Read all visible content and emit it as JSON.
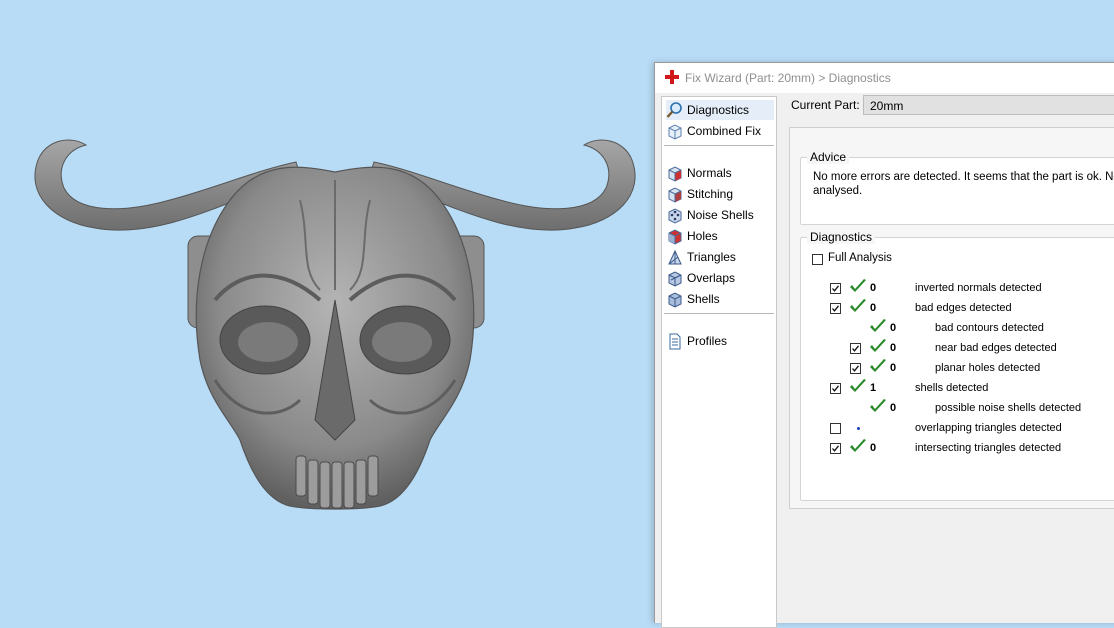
{
  "window": {
    "title": "Fix Wizard (Part: 20mm) > Diagnostics",
    "accent_color": "#d01818"
  },
  "nav": {
    "items": [
      {
        "label": "Diagnostics",
        "icon": "magnifier-icon",
        "selected": true
      },
      {
        "label": "Combined Fix",
        "icon": "cube-outline-icon"
      },
      {
        "label": "Normals",
        "icon": "cube-red-icon"
      },
      {
        "label": "Stitching",
        "icon": "cube-stitch-icon"
      },
      {
        "label": "Noise Shells",
        "icon": "cube-dots-icon"
      },
      {
        "label": "Holes",
        "icon": "cube-holes-icon"
      },
      {
        "label": "Triangles",
        "icon": "triangle-icon"
      },
      {
        "label": "Overlaps",
        "icon": "cube-overlap-icon"
      },
      {
        "label": "Shells",
        "icon": "cube-shells-icon"
      },
      {
        "label": "Profiles",
        "icon": "document-icon"
      }
    ]
  },
  "current_part": {
    "label": "Current Part:",
    "value": "20mm"
  },
  "advice": {
    "title": "Advice",
    "text": "No more errors are detected. It seems that the part is ok. No analysed."
  },
  "diagnostics": {
    "title": "Diagnostics",
    "full_analysis_label": "Full Analysis",
    "full_analysis_checked": false,
    "ok_color": "#2a8a2a",
    "rows": [
      {
        "checkbox": true,
        "checked": true,
        "status": "ok",
        "count": "0",
        "text": "inverted normals detected",
        "indent": 0
      },
      {
        "checkbox": true,
        "checked": true,
        "status": "ok",
        "count": "0",
        "text": "bad edges detected",
        "indent": 0
      },
      {
        "checkbox": false,
        "checked": false,
        "status": "ok",
        "count": "0",
        "text": "bad contours detected",
        "indent": 1
      },
      {
        "checkbox": true,
        "checked": true,
        "status": "ok",
        "count": "0",
        "text": "near bad edges detected",
        "indent": 1
      },
      {
        "checkbox": true,
        "checked": true,
        "status": "ok",
        "count": "0",
        "text": "planar holes detected",
        "indent": 1
      },
      {
        "checkbox": true,
        "checked": true,
        "status": "ok",
        "count": "1",
        "text": "shells detected",
        "indent": 0
      },
      {
        "checkbox": false,
        "checked": false,
        "status": "ok",
        "count": "0",
        "text": "possible noise shells detected",
        "indent": 1
      },
      {
        "checkbox": true,
        "checked": false,
        "status": "pending",
        "count": "",
        "text": "overlapping triangles detected",
        "indent": 0
      },
      {
        "checkbox": true,
        "checked": true,
        "status": "ok",
        "count": "0",
        "text": "intersecting triangles detected",
        "indent": 0
      }
    ]
  }
}
